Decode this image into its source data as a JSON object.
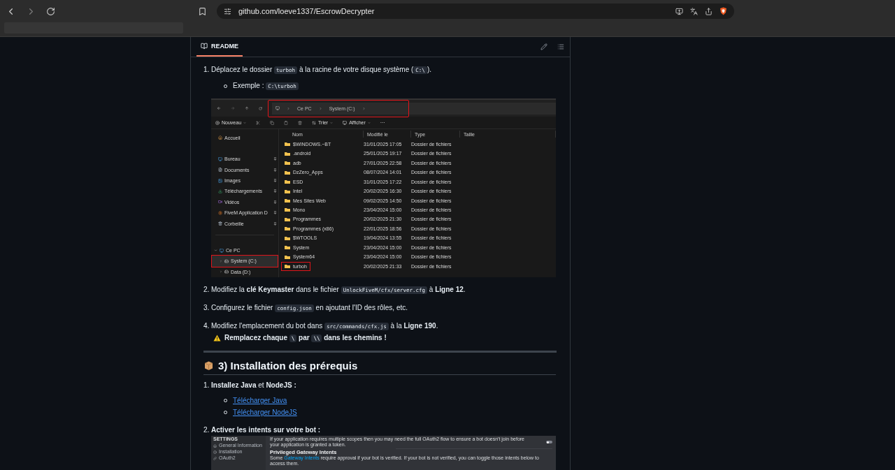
{
  "browser": {
    "address": "github.com/loeve1337/EscrowDecrypter"
  },
  "readme": {
    "tab": "README",
    "selected": true
  },
  "content": [
    {
      "kind": "item",
      "number": "1.",
      "parts": [
        {
          "kind": "text",
          "t": "Déplacez le dossier "
        },
        {
          "kind": "code",
          "t": "turboh"
        },
        {
          "kind": "text",
          "t": " à la racine de votre disque système ("
        },
        {
          "kind": "code",
          "t": "C:\\"
        },
        {
          "kind": "text",
          "t": ")."
        }
      ],
      "bullets": [
        [
          {
            "kind": "text",
            "t": "Exemple : "
          },
          {
            "kind": "code",
            "t": "C:\\turboh"
          }
        ]
      ]
    },
    {
      "kind": "explorer",
      "path": [
        "Ce PC",
        "System (C:)"
      ],
      "path_highlighted": true,
      "toolbar": {
        "new": "Nouveau",
        "sort": "Trier",
        "view": "Afficher",
        "more": "···"
      },
      "sidebar": [
        {
          "label": "Accueil",
          "pinned": false
        },
        {
          "label": "Bureau",
          "pinned": true
        },
        {
          "label": "Documents",
          "pinned": true
        },
        {
          "label": "Images",
          "pinned": true
        },
        {
          "label": "Téléchargements",
          "pinned": true
        },
        {
          "label": "Vidéos",
          "pinned": true
        },
        {
          "label": "FiveM Application D",
          "pinned": true
        },
        {
          "label": "Corbeille",
          "pinned": true
        }
      ],
      "drives": {
        "label": "Ce PC",
        "expanded": true,
        "children": [
          {
            "label": "System (C:)",
            "selected": true
          },
          {
            "label": "Data (D:)",
            "selected": false
          }
        ]
      },
      "columns": [
        "Nom",
        "Modifié le",
        "Type",
        "Taille"
      ],
      "rows": [
        {
          "name": "$WINDOWS.~BT",
          "modified": "31/01/2025 17:05",
          "type": "Dossier de fichiers",
          "highlighted": false
        },
        {
          "name": ".android",
          "modified": "25/01/2025 19:17",
          "type": "Dossier de fichiers",
          "highlighted": false
        },
        {
          "name": "adb",
          "modified": "27/01/2025 22:58",
          "type": "Dossier de fichiers",
          "highlighted": false
        },
        {
          "name": "DzZero_Apps",
          "modified": "08/07/2024 14:01",
          "type": "Dossier de fichiers",
          "highlighted": false
        },
        {
          "name": "ESD",
          "modified": "31/01/2025 17:22",
          "type": "Dossier de fichiers",
          "highlighted": false
        },
        {
          "name": "Intel",
          "modified": "20/02/2025 16:30",
          "type": "Dossier de fichiers",
          "highlighted": false
        },
        {
          "name": "Mes Sites Web",
          "modified": "09/02/2025 14:50",
          "type": "Dossier de fichiers",
          "highlighted": false
        },
        {
          "name": "Mono",
          "modified": "23/04/2024 15:00",
          "type": "Dossier de fichiers",
          "highlighted": false
        },
        {
          "name": "Programmes",
          "modified": "20/02/2025 21:30",
          "type": "Dossier de fichiers",
          "highlighted": false
        },
        {
          "name": "Programmes (x86)",
          "modified": "22/01/2025 18:56",
          "type": "Dossier de fichiers",
          "highlighted": false
        },
        {
          "name": "$WTOOLS",
          "modified": "19/04/2024 13:55",
          "type": "Dossier de fichiers",
          "highlighted": false
        },
        {
          "name": "System",
          "modified": "23/04/2024 15:00",
          "type": "Dossier de fichiers",
          "highlighted": false
        },
        {
          "name": "System64",
          "modified": "23/04/2024 15:00",
          "type": "Dossier de fichiers",
          "highlighted": false
        },
        {
          "name": "turboh",
          "modified": "20/02/2025 21:33",
          "type": "Dossier de fichiers",
          "highlighted": true
        }
      ]
    },
    {
      "kind": "item",
      "number": "2.",
      "parts": [
        {
          "kind": "text",
          "t": "Modifiez la **clé Keymaster** dans le fichier "
        },
        {
          "kind": "code",
          "t": "UnlockFiveM/cfx/server.cfg"
        },
        {
          "kind": "text",
          "t": " à **Ligne 12**."
        }
      ]
    },
    {
      "kind": "item",
      "number": "3.",
      "parts": [
        {
          "kind": "text",
          "t": "Configurez le fichier "
        },
        {
          "kind": "code",
          "t": "config.json"
        },
        {
          "kind": "text",
          "t": " en ajoutant l'ID des rôles, etc."
        }
      ]
    },
    {
      "kind": "item",
      "number": "4.",
      "parts": [
        {
          "kind": "text",
          "t": "Modifiez l'emplacement du bot dans "
        },
        {
          "kind": "code",
          "t": "src/commands/cfx.js"
        },
        {
          "kind": "text",
          "t": " à la **Ligne 190**."
        }
      ],
      "warning": [
        {
          "kind": "text",
          "t": "Remplacez chaque "
        },
        {
          "kind": "code",
          "t": "\\"
        },
        {
          "kind": "text",
          "t": " par "
        },
        {
          "kind": "code",
          "t": "\\\\"
        },
        {
          "kind": "text",
          "t": " dans les chemins !"
        }
      ]
    },
    {
      "kind": "hr"
    },
    {
      "kind": "heading",
      "text": "3) Installation des prérequis"
    },
    {
      "kind": "item",
      "number": "1.",
      "parts": [
        {
          "kind": "text",
          "t": "**Installez Java** et **NodeJS :**"
        }
      ],
      "links": [
        "Télécharger Java",
        "Télécharger NodeJS"
      ]
    },
    {
      "kind": "item",
      "number": "2.",
      "parts": [
        {
          "kind": "text",
          "t": "**Activer les intents sur votre bot :**"
        }
      ],
      "media": {
        "heading": "SETTINGS",
        "nav": [
          "General Information",
          "Installation",
          "OAuth2"
        ],
        "note": "If your application requires multiple scopes then you may need the full OAuth2 flow to ensure a bot doesn't join before your application is granted a token.",
        "toggle_on": false,
        "section_title": "Privileged Gateway Intents",
        "section_text": [
          {
            "kind": "text",
            "t": "Some "
          },
          {
            "kind": "link",
            "t": "Gateway Intents"
          },
          {
            "kind": "text",
            "t": " require approval if your bot is verified. If your bot is not verified, you can toggle those intents below to access them."
          }
        ]
      }
    }
  ]
}
